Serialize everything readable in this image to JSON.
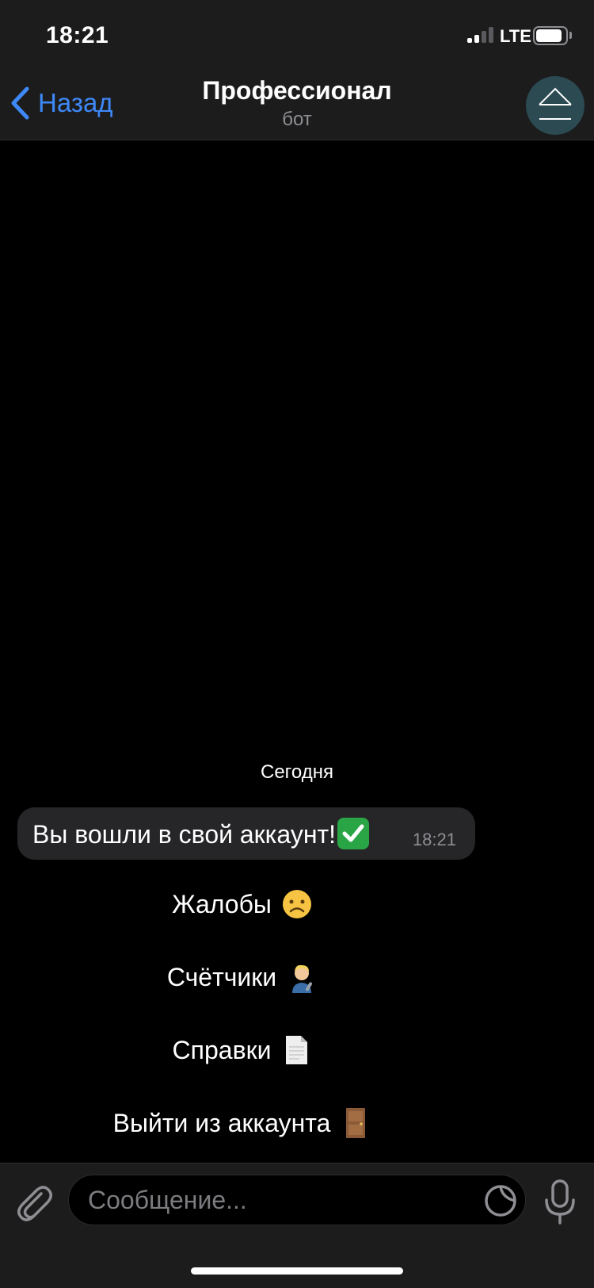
{
  "status_bar": {
    "time": "18:21",
    "network": "LTE",
    "battery_percent": 90
  },
  "nav": {
    "back_label": "Назад",
    "title": "Профессионал",
    "subtitle": "бот"
  },
  "chat": {
    "date_separator": "Сегодня",
    "messages": [
      {
        "text": "Вы вошли в свой аккаунт!",
        "emoji": "check-mark-button-emoji",
        "time": "18:21"
      }
    ]
  },
  "keyboard": {
    "buttons": [
      {
        "label": "Жалобы",
        "icon": "frowning-face-emoji"
      },
      {
        "label": "Счётчики",
        "icon": "mechanic-emoji"
      },
      {
        "label": "Справки",
        "icon": "page-document-emoji"
      },
      {
        "label": "Выйти из аккаунта",
        "icon": "door-emoji"
      }
    ]
  },
  "input": {
    "placeholder": "Сообщение..."
  },
  "colors": {
    "accent": "#3e88f7",
    "bar_bg": "#1c1c1d",
    "bubble_bg": "#262628",
    "muted": "#8e8e93"
  }
}
